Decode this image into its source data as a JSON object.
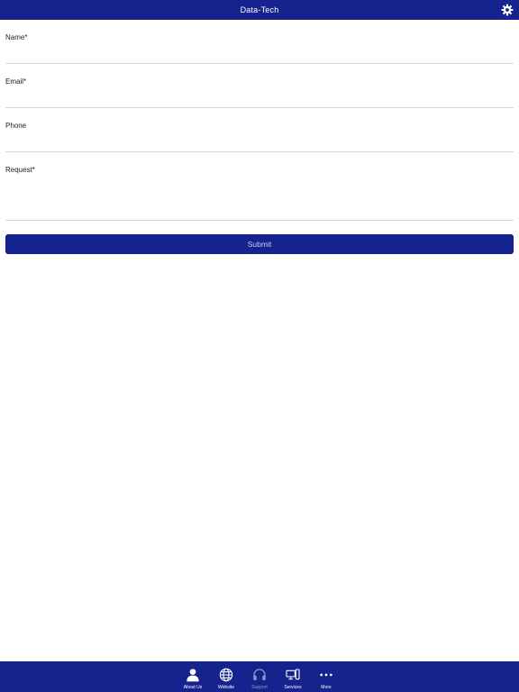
{
  "header": {
    "title": "Data-Tech",
    "settings_icon": "gear-icon"
  },
  "form": {
    "name_label": "Name*",
    "name_value": "",
    "email_label": "Email*",
    "email_value": "",
    "phone_label": "Phone",
    "phone_value": "",
    "request_label": "Request*",
    "request_value": "",
    "submit_label": "Submit"
  },
  "tabbar": {
    "items": [
      {
        "label": "About Us",
        "icon": "person-icon"
      },
      {
        "label": "Website",
        "icon": "globe-icon"
      },
      {
        "label": "Support",
        "icon": "headphones-icon",
        "selected": true
      },
      {
        "label": "Services",
        "icon": "devices-icon"
      },
      {
        "label": "More",
        "icon": "more-icon"
      }
    ]
  },
  "colors": {
    "brand": "#16238f",
    "tab_selected_label": "#8f96c8",
    "divider": "#d6d6d6"
  }
}
